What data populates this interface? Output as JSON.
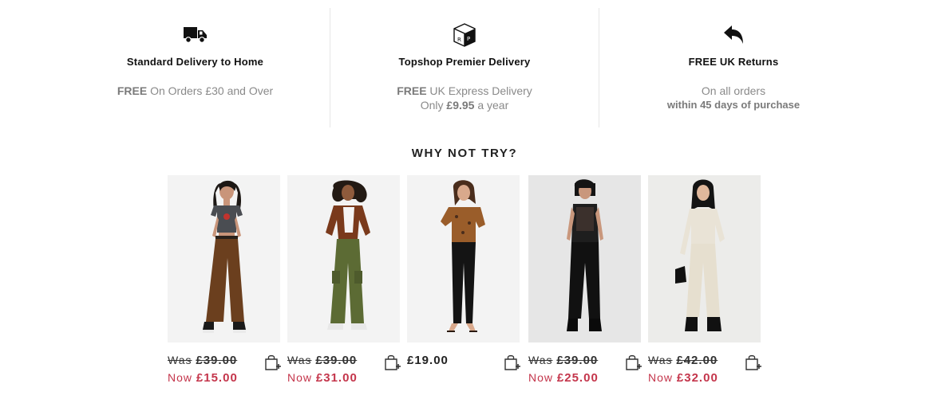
{
  "delivery": [
    {
      "icon": "truck-icon",
      "title": "Standard Delivery to Home",
      "line1_bold": "FREE",
      "line1_rest": " On Orders £30 and Over",
      "line2_pre": "",
      "line2_bold": "",
      "line2_post": ""
    },
    {
      "icon": "premier-box-icon",
      "title": "Topshop Premier Delivery",
      "line1_bold": "FREE",
      "line1_rest": " UK Express Delivery",
      "line2_pre": "Only ",
      "line2_bold": "£9.95",
      "line2_post": " a year"
    },
    {
      "icon": "return-arrow-icon",
      "title": "FREE UK Returns",
      "line1_bold": "",
      "line1_rest": "On all orders",
      "line2_pre": "",
      "line2_bold": "within 45 days of purchase",
      "line2_post": ""
    }
  ],
  "section_title": "WHY NOT TRY?",
  "products": [
    {
      "image": "model-brown-cargo-trousers",
      "was_word": "Was",
      "was_price": "£39.00",
      "now_word": "Now",
      "now_price": "£15.00",
      "price": ""
    },
    {
      "image": "model-khaki-cargo-trousers",
      "was_word": "Was",
      "was_price": "£39.00",
      "now_word": "Now",
      "now_price": "£31.00",
      "price": ""
    },
    {
      "image": "model-black-leggings",
      "was_word": "",
      "was_price": "",
      "now_word": "",
      "now_price": "",
      "price": "£19.00"
    },
    {
      "image": "model-black-leather-trousers",
      "was_word": "Was",
      "was_price": "£39.00",
      "now_word": "Now",
      "now_price": "£25.00",
      "price": ""
    },
    {
      "image": "model-ecru-cargo-trousers",
      "was_word": "Was",
      "was_price": "£42.00",
      "now_word": "Now",
      "now_price": "£32.00",
      "price": ""
    }
  ],
  "colors": {
    "sale_red": "#c4354b",
    "text_dark": "#222222",
    "text_grey": "#8a8a8a",
    "image_bg": "#f3f3f3"
  }
}
